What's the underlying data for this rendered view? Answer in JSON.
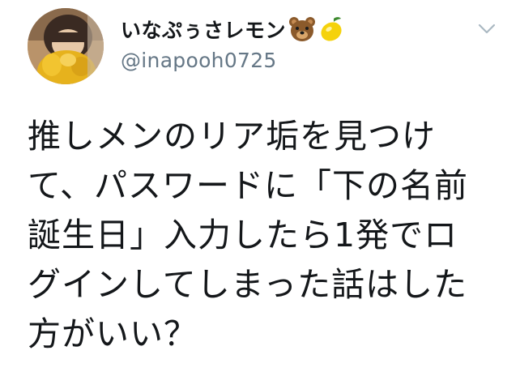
{
  "tweet": {
    "display_name": "いなぷぅさレモン",
    "name_emojis": [
      "bear-emoji",
      "lemon-emoji"
    ],
    "handle": "@inapooh0725",
    "text_lines": [
      "推しメンのリア垢を見つけ",
      "て、パスワードに「下の名前",
      "誕生日」入力したら1発でロ",
      "グインしてしまった話はした",
      "方がいい？"
    ],
    "menu_icon": "chevron-down-icon"
  },
  "colors": {
    "text": "#14171a",
    "secondary_text": "#657786",
    "caret": "#aab8c2",
    "background": "#ffffff"
  }
}
